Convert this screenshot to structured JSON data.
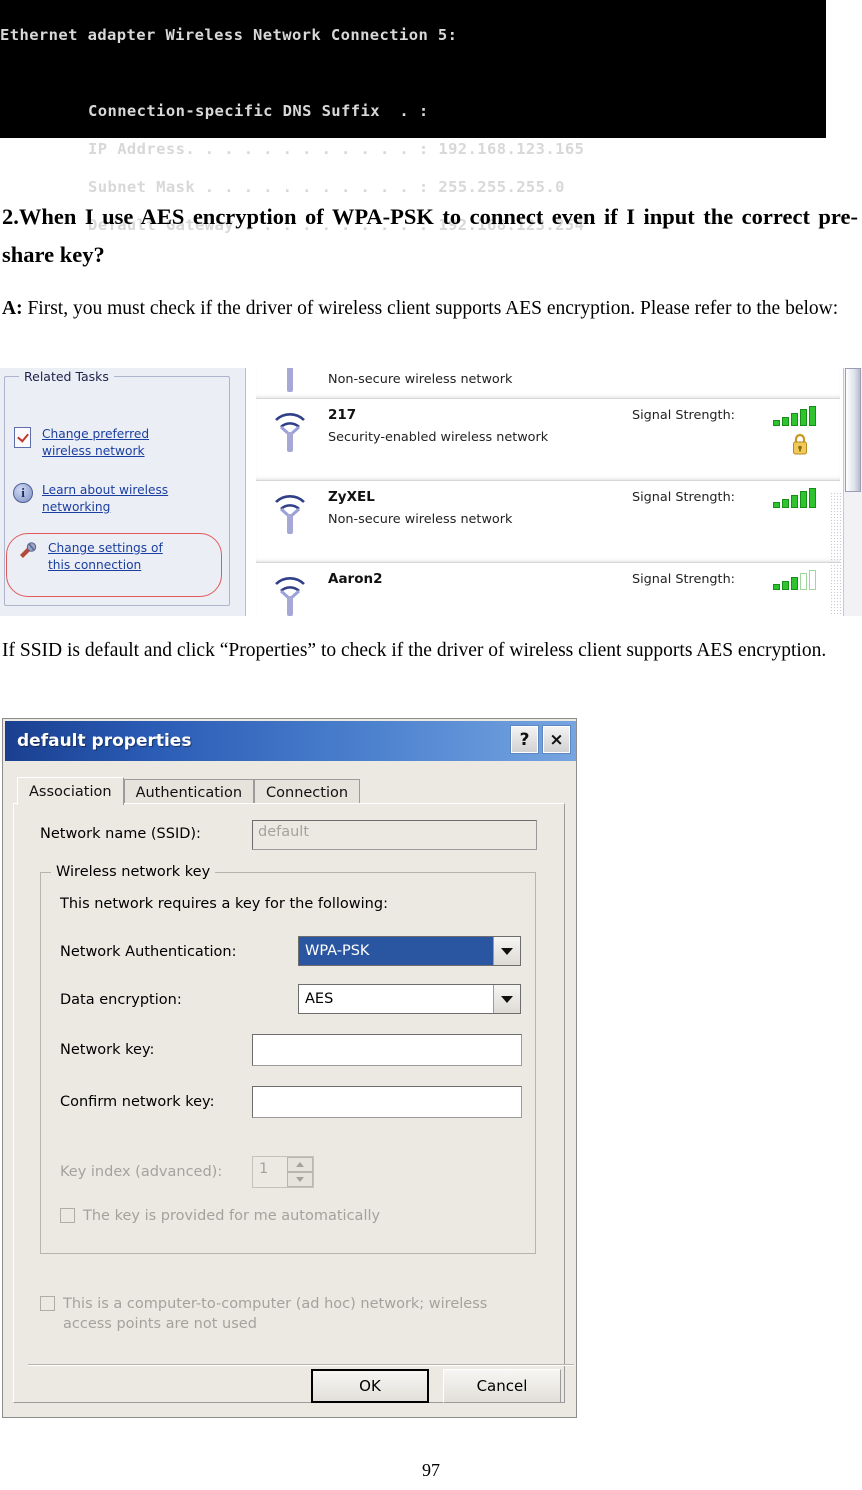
{
  "terminal": {
    "lines": [
      "Ethernet adapter Wireless Network Connection 5:",
      "",
      "Connection-specific DNS Suffix  . :",
      "IP Address. . . . . . . . . . . . : 192.168.123.165",
      "Subnet Mask . . . . . . . . . . . : 255.255.255.0",
      "Default Gateway . . . . . . . . . : 192.168.123.254"
    ],
    "header": "Ethernet adapter Wireless Network Connection 5:",
    "rows": [
      "Connection-specific DNS Suffix  . :",
      "IP Address. . . . . . . . . . . . : 192.168.123.165",
      "Subnet Mask . . . . . . . . . . . : 255.255.255.0",
      "Default Gateway . . . . . . . . . : 192.168.123.254"
    ]
  },
  "document": {
    "heading": "2.When I use AES encryption of WPA-PSK to connect even if I input the correct pre-share key?",
    "answer_prefix": "A:",
    "answer_text": " First, you must check if the driver of wireless client supports AES encryption. Please refer to the below:",
    "ssid_paragraph": "If SSID is default and click “Properties” to check if the driver of wireless client supports AES encryption.",
    "page_number": "97"
  },
  "wifi_screenshot": {
    "related_tasks": {
      "title": "Related Tasks",
      "items": [
        {
          "label": "Change preferred wireless network",
          "icon": "document-check-icon"
        },
        {
          "label": "Learn about wireless networking",
          "icon": "info-icon"
        },
        {
          "label": "Change settings of this connection",
          "icon": "wrench-icon",
          "highlighted": true
        }
      ],
      "highlight_color": "#e05a5a"
    },
    "networks": [
      {
        "name": "",
        "description": "Non-secure wireless network",
        "signal_label": "",
        "bars_filled": 0,
        "secured": false
      },
      {
        "name": "217",
        "description": "Security-enabled wireless network",
        "signal_label": "Signal Strength:",
        "bars_filled": 4,
        "secured": true
      },
      {
        "name": "ZyXEL",
        "description": "Non-secure wireless network",
        "signal_label": "Signal Strength:",
        "bars_filled": 4,
        "secured": false
      },
      {
        "name": "Aaron2",
        "description": "",
        "signal_label": "Signal Strength:",
        "bars_filled": 3,
        "secured": false
      }
    ],
    "signal_color": "#2fc32f"
  },
  "dialog": {
    "title": "default properties",
    "help_button": "?",
    "close_button": "×",
    "tabs": [
      {
        "label": "Association",
        "active": true
      },
      {
        "label": "Authentication",
        "active": false
      },
      {
        "label": "Connection",
        "active": false
      }
    ],
    "ssid_label": "Network name (SSID):",
    "ssid_value": "default",
    "key_group_title": "Wireless network key",
    "key_group_note": "This network requires a key for the following:",
    "network_auth_label": "Network Authentication:",
    "network_auth_value": "WPA-PSK",
    "data_encryption_label": "Data encryption:",
    "data_encryption_value": "AES",
    "network_key_label": "Network key:",
    "network_key_value": "",
    "confirm_key_label": "Confirm network key:",
    "confirm_key_value": "",
    "key_index_label": "Key index (advanced):",
    "key_index_value": "1",
    "auto_key_label": "The key is provided for me automatically",
    "adhoc_label": "This is a computer-to-computer (ad hoc) network; wireless access points are not used",
    "ok_button": "OK",
    "cancel_button": "Cancel",
    "title_color": "#1a3f8f",
    "selection_color": "#2a55a0"
  }
}
